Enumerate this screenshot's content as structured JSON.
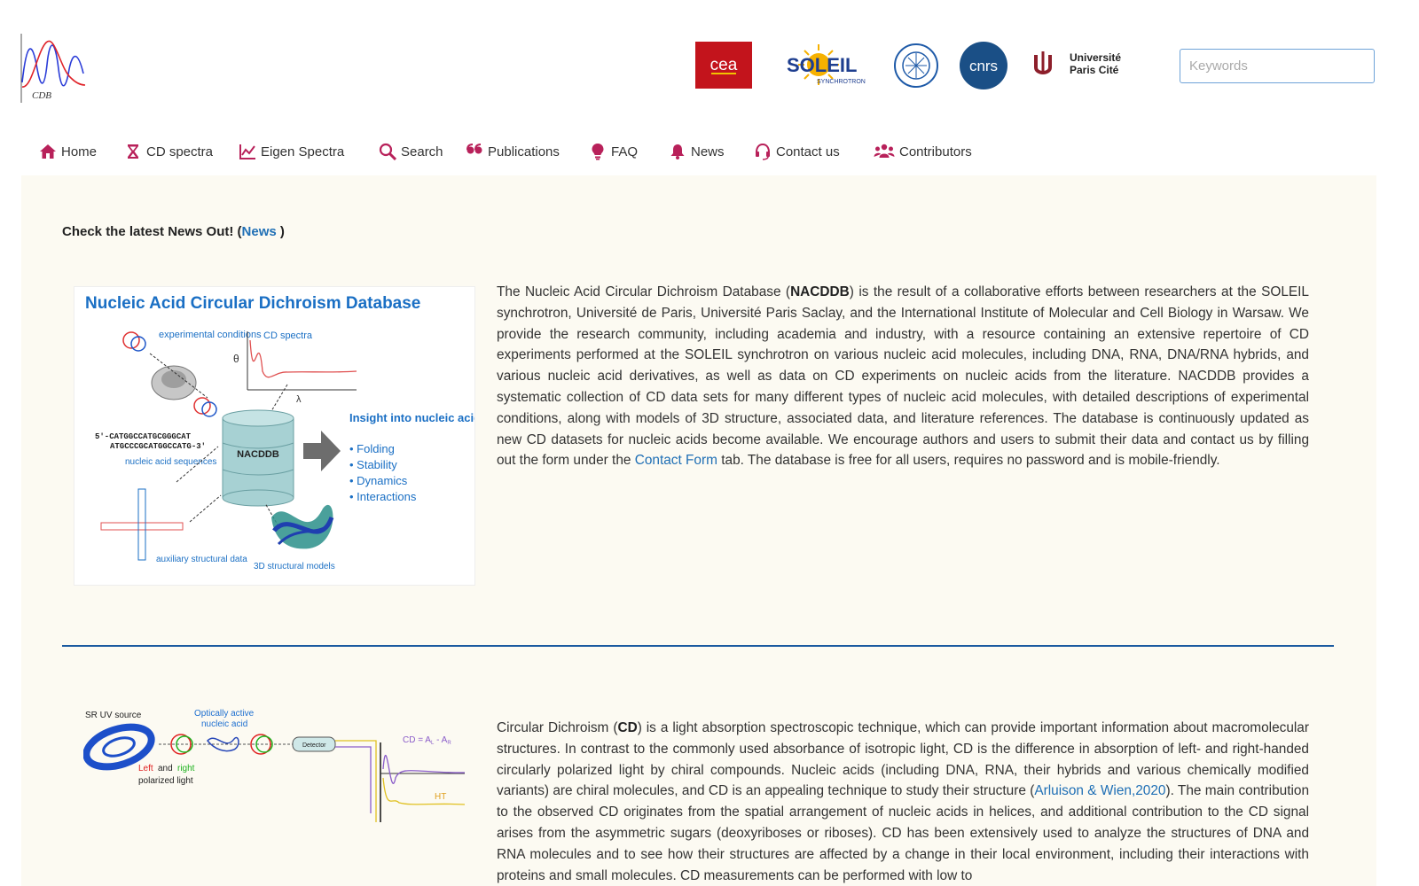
{
  "header": {
    "logo_text": "CDB",
    "partner_logos": [
      "cea",
      "SOLEIL SYNCHROTRON",
      "seal",
      "cnrs",
      "Université Paris Cité"
    ],
    "search": {
      "placeholder": "Keywords",
      "value": ""
    }
  },
  "nav": {
    "items": [
      {
        "label": "Home",
        "icon": "home-icon"
      },
      {
        "label": "CD spectra",
        "icon": "hourglass-icon"
      },
      {
        "label": "Eigen Spectra",
        "icon": "line-chart-icon"
      },
      {
        "label": "Search",
        "icon": "search-icon"
      },
      {
        "label": "Publications",
        "icon": "quote-icon"
      },
      {
        "label": "FAQ",
        "icon": "lightbulb-icon"
      },
      {
        "label": "News",
        "icon": "bell-icon"
      },
      {
        "label": "Contact us",
        "icon": "headset-icon"
      },
      {
        "label": "Contributors",
        "icon": "users-icon"
      }
    ]
  },
  "news": {
    "prefix": "Check the latest News Out! (",
    "link": "News",
    "suffix": " )"
  },
  "figure1": {
    "title": "Nucleic Acid Circular Dichroism Database",
    "experimental_conditions": "experimental conditions",
    "cd_spectra": "CD spectra",
    "theta": "θ",
    "lambda": "λ",
    "seq1": "5'-CATGGCCATGCGGGCAT",
    "seq2": "ATGCCCGCATGGCCATG-3'",
    "nucleic_acid_sequences": "nucleic acid sequences",
    "db_label": "NACDDB",
    "insight_title": "Insight into nucleic acids:",
    "bullets": [
      "Folding",
      "Stability",
      "Dynamics",
      "Interactions"
    ],
    "auxiliary": "auxiliary structural data",
    "models": "3D structural models"
  },
  "intro": {
    "t1": "The Nucleic Acid Circular Dichroism Database (",
    "bold": "NACDDB",
    "t2": ") is the result of a collaborative efforts between researchers at the SOLEIL synchrotron, Université de Paris, Université Paris Saclay, and the International Institute of Molecular and Cell Biology in Warsaw. We provide the research community, including academia and industry, with a resource containing an extensive repertoire of CD experiments performed at the SOLEIL synchrotron on various nucleic acid molecules, including DNA, RNA, DNA/RNA hybrids, and various nucleic acid derivatives, as well as data on CD experiments on nucleic acids from the literature. NACDDB provides a systematic collection of CD data sets for many different types of nucleic acid molecules, with detailed descriptions of experimental conditions, along with models of 3D structure, associated data, and literature references. The database is continuously updated as new CD datasets for nucleic acids become available. We encourage authors and users to submit their data and contact us by filling out the form under the ",
    "link": "Contact Form",
    "t3": " tab. The database is free for all users, requires no password and is mobile-friendly."
  },
  "figure2": {
    "sr_uv_source": "SR UV source",
    "optically_active": "Optically active nucleic acid",
    "detector": "Detector",
    "left": "Left",
    "and": "and",
    "right": "right",
    "polarized": "polarized light",
    "cd_formula": "CD = A",
    "sub_l": "L",
    "minus": " - A",
    "sub_r": "R",
    "ht": "HT"
  },
  "cd_section": {
    "t1": "Circular Dichroism (",
    "bold": "CD",
    "t2": ") is a light absorption spectroscopic technique, which can provide important information about macromolecular structures. In contrast to the commonly used absorbance of isotropic light, CD is the difference in absorption of left- and right-handed circularly polarized light by chiral compounds. Nucleic acids (including DNA, RNA, their hybrids and various chemically modified variants) are chiral molecules, and CD is an appealing technique to study their structure (",
    "link": "Arluison & Wien,2020",
    "t3": "). The main contribution to the observed CD originates from the spatial arrangement of nucleic acids in helices, and additional contribution to the CD signal arises from the asymmetric sugars (deoxyriboses or riboses). CD has been extensively used to analyze the structures of DNA and RNA molecules and to see how their structures are affected by a change in their local environment, including their interactions with proteins and small molecules. CD measurements can be performed with low to"
  },
  "colors": {
    "accent": "#1f6fb5",
    "nav_icon": "#b8215a",
    "separator": "#1b5aa0",
    "content_bg": "#fcfaf2"
  }
}
